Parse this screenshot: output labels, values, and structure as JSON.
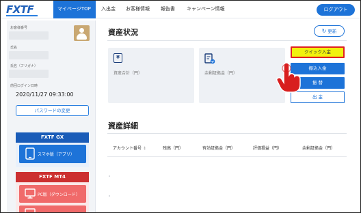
{
  "header": {
    "logo": "FXTF",
    "nav": [
      "マイページTOP",
      "入出金",
      "お客様情報",
      "報告書",
      "キャンペーン情報"
    ],
    "logout_label": "ログアウト"
  },
  "sidebar": {
    "customer_id_label": "お客様番号",
    "name_label": "氏名",
    "name_kana_label": "氏名（フリガナ）",
    "last_login_label": "前回ログイン日時",
    "last_login_value": "2020/11/27 09:33:00",
    "password_button": "パスワードの変更",
    "gx_title": "FXTF GX",
    "gx_app_button": "スマホ版（アプリ）",
    "mt4_title": "FXTF MT4",
    "mt4_pc_button": "PC版（ダウンロード）"
  },
  "assets": {
    "title": "資産状況",
    "refresh_label": "更新",
    "total_label": "資産合計（円）",
    "margin_label": "余剰証拠金（円）",
    "buttons": {
      "quick_deposit": "クイック入金",
      "transfer_in": "振込入金",
      "transfer": "振 替",
      "withdraw": "出 金"
    }
  },
  "details": {
    "title": "資産詳細",
    "columns": [
      "アカウント番号",
      "残高（円）",
      "有効証拠金（円）",
      "評価損益（円）",
      "余剰証拠金（円）"
    ]
  },
  "colors": {
    "primary_blue": "#1d73d8",
    "highlight_yellow": "#f1f20e",
    "highlight_border": "#e02020",
    "mt4_red": "#cc3030"
  }
}
